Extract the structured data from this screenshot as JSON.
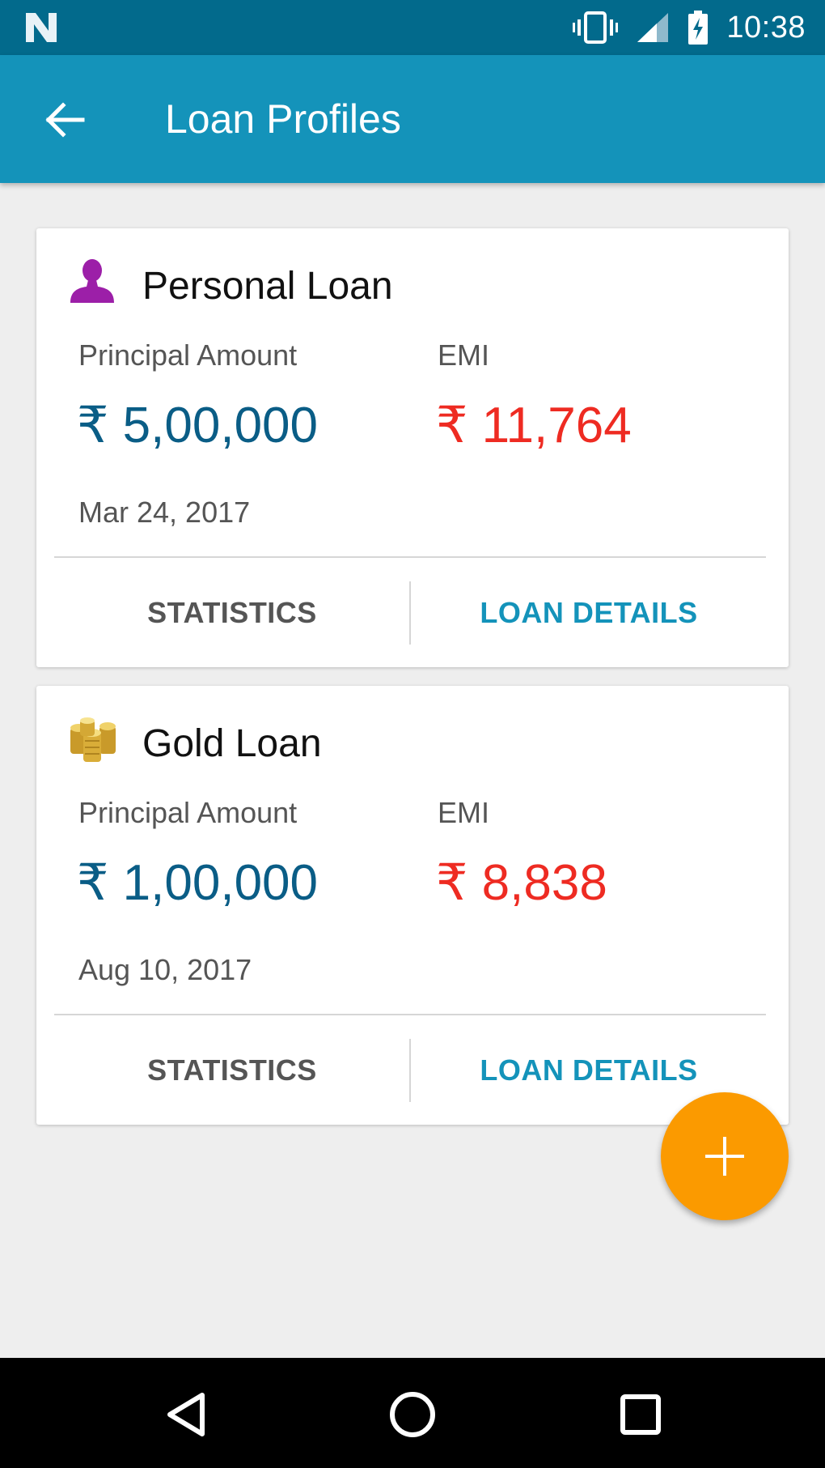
{
  "status_bar": {
    "time": "10:38",
    "icons": [
      "n-logo-icon",
      "vibrate-icon",
      "signal-icon",
      "battery-charging-icon"
    ]
  },
  "app_bar": {
    "title": "Loan Profiles",
    "back_icon": "arrow-back-icon"
  },
  "loans": [
    {
      "title": "Personal Loan",
      "icon": "person-icon",
      "icon_color": "#9c1fa8",
      "principal_label": "Principal Amount",
      "principal_value": "₹ 5,00,000",
      "emi_label": "EMI",
      "emi_value": "₹ 11,764",
      "date": "Mar 24, 2017",
      "statistics_label": "STATISTICS",
      "details_label": "LOAN DETAILS"
    },
    {
      "title": "Gold Loan",
      "icon": "gold-coins-icon",
      "icon_color": "#d9b23a",
      "principal_label": "Principal Amount",
      "principal_value": "₹ 1,00,000",
      "emi_label": "EMI",
      "emi_value": "₹ 8,838",
      "date": "Aug 10, 2017",
      "statistics_label": "STATISTICS",
      "details_label": "LOAN DETAILS"
    }
  ],
  "fab": {
    "icon": "plus-icon",
    "color": "#fb9a00"
  },
  "colors": {
    "status_bar": "#026a8c",
    "app_bar": "#1493ba",
    "principal": "#0a5d86",
    "emi": "#ee2b22",
    "accent": "#1493ba"
  },
  "nav_bar": {
    "icons": [
      "nav-back-icon",
      "nav-home-icon",
      "nav-recent-icon"
    ]
  }
}
